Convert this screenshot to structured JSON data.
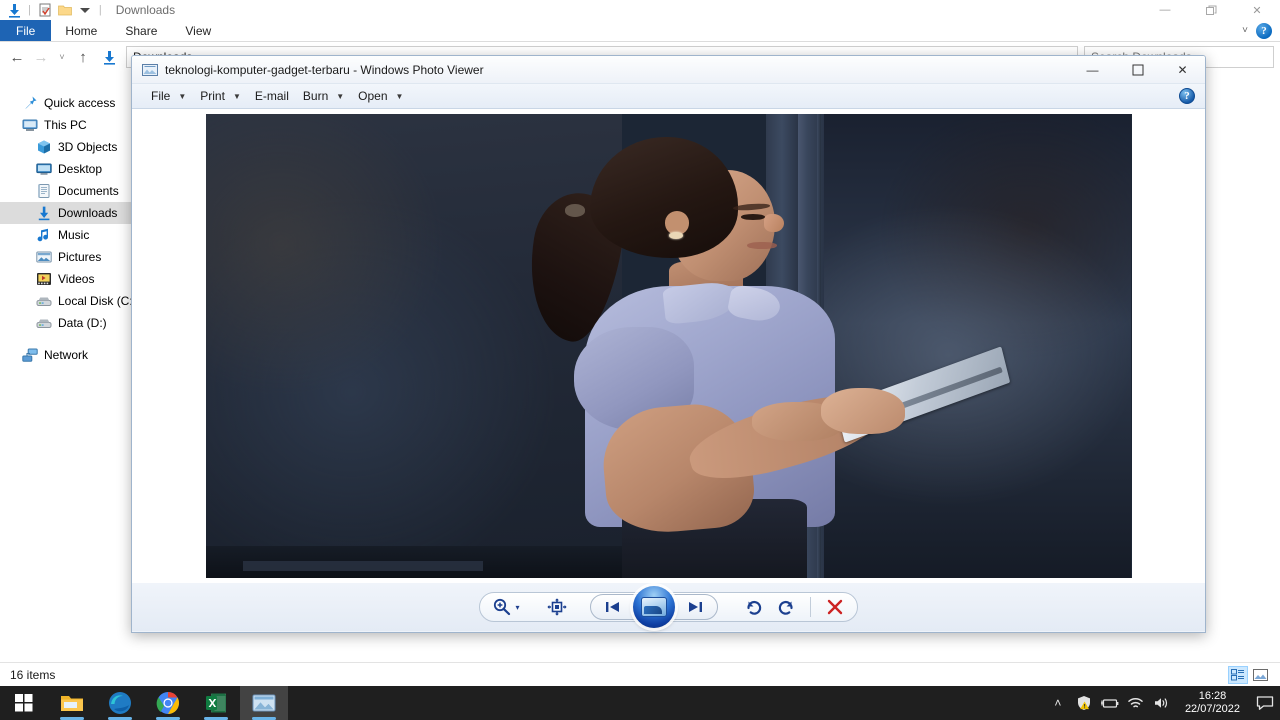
{
  "explorer": {
    "quick_access_toolbar": {
      "title": "Downloads",
      "icons": [
        "download-icon",
        "properties-icon",
        "new-folder-icon",
        "customize-dropdown-icon"
      ]
    },
    "window_controls": {
      "minimize": "—",
      "restore": "❐",
      "close": "✕"
    },
    "ribbon_tabs": [
      {
        "label": "File"
      },
      {
        "label": "Home"
      },
      {
        "label": "Share"
      },
      {
        "label": "View"
      }
    ],
    "ribbon_right": {
      "collapse": "˅",
      "help": "?"
    },
    "nav": {
      "back": "←",
      "forward": "→",
      "recent": "˅",
      "up": "↑",
      "address_value": "Downloads",
      "search_placeholder": "Search Downloads"
    },
    "sidebar": {
      "items": [
        {
          "label": "Quick access",
          "icon": "pin-icon",
          "level": 1,
          "selected": false
        },
        {
          "label": "This PC",
          "icon": "computer-icon",
          "level": 1,
          "selected": false
        },
        {
          "label": "3D Objects",
          "icon": "3d-objects-icon",
          "level": 2,
          "selected": false
        },
        {
          "label": "Desktop",
          "icon": "desktop-icon",
          "level": 2,
          "selected": false
        },
        {
          "label": "Documents",
          "icon": "documents-icon",
          "level": 2,
          "selected": false
        },
        {
          "label": "Downloads",
          "icon": "downloads-icon",
          "level": 2,
          "selected": true
        },
        {
          "label": "Music",
          "icon": "music-icon",
          "level": 2,
          "selected": false
        },
        {
          "label": "Pictures",
          "icon": "pictures-icon",
          "level": 2,
          "selected": false
        },
        {
          "label": "Videos",
          "icon": "videos-icon",
          "level": 2,
          "selected": false
        },
        {
          "label": "Local Disk (C:)",
          "icon": "hard-disk-icon",
          "level": 2,
          "selected": false
        },
        {
          "label": "Data (D:)",
          "icon": "hard-disk-icon",
          "level": 2,
          "selected": false
        },
        {
          "label": "Network",
          "icon": "network-icon",
          "level": 1,
          "selected": false
        }
      ]
    },
    "status": {
      "item_count": "16 items",
      "view_details": "details-view-icon",
      "view_large": "large-icons-view-icon"
    }
  },
  "photo_viewer": {
    "title": "teknologi-komputer-gadget-terbaru - Windows Photo Viewer",
    "title_icon": "photo-viewer-icon",
    "window_controls": {
      "minimize": "—",
      "maximize": "☐",
      "close": "✕"
    },
    "menu": [
      {
        "label": "File",
        "has_caret": true
      },
      {
        "label": "Print",
        "has_caret": true
      },
      {
        "label": "E-mail",
        "has_caret": false
      },
      {
        "label": "Burn",
        "has_caret": true
      },
      {
        "label": "Open",
        "has_caret": true
      }
    ],
    "help_label": "?",
    "toolbar": {
      "zoom": "zoom-icon",
      "zoom_caret": "▾",
      "fit_to_window": "fit-to-window-icon",
      "previous": "previous-image-icon",
      "play_slideshow": "play-slideshow-icon",
      "next": "next-image-icon",
      "rotate_ccw": "rotate-counterclockwise-icon",
      "rotate_cw": "rotate-clockwise-icon",
      "delete": "delete-icon"
    },
    "image": {
      "alt": "Woman in light blue blouse holding a tablet in front of a dark blue-gray wall",
      "background_color": "#1c2635",
      "blouse_color": "#9aa1c6",
      "skin_color": "#c08f72",
      "hair_color": "#241712"
    }
  },
  "taskbar": {
    "start": "windows-start-icon",
    "apps": [
      {
        "name": "file-explorer-icon",
        "active": false,
        "running": true
      },
      {
        "name": "microsoft-edge-icon",
        "active": false,
        "running": true
      },
      {
        "name": "google-chrome-icon",
        "active": false,
        "running": true
      },
      {
        "name": "microsoft-excel-icon",
        "active": false,
        "running": true
      },
      {
        "name": "windows-photo-viewer-icon",
        "active": true,
        "running": true
      }
    ],
    "tray": {
      "show_hidden": "˄",
      "icons": [
        "security-warning-icon",
        "battery-icon",
        "wifi-icon",
        "volume-icon"
      ],
      "time": "16:28",
      "date": "22/07/2022",
      "action_center": "action-center-icon"
    }
  }
}
